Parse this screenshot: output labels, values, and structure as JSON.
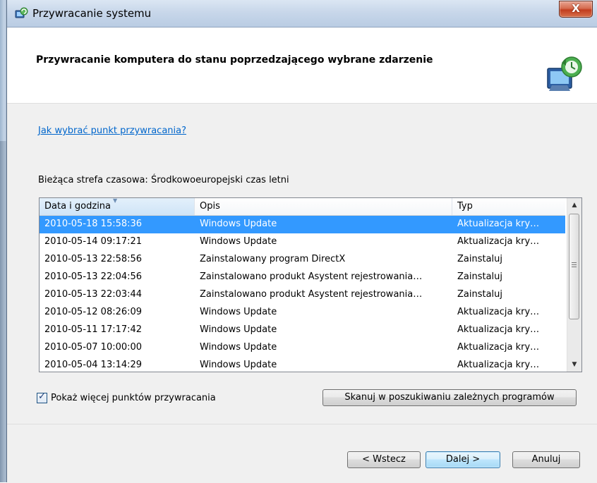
{
  "window": {
    "title": "Przywracanie systemu",
    "close_label": "X"
  },
  "header": {
    "heading": "Przywracanie komputera do stanu poprzedzającego wybrane zdarzenie"
  },
  "content": {
    "help_link": "Jak wybrać punkt przywracania?",
    "timezone_label": "Bieżąca strefa czasowa: Środkowoeuropejski czas letni",
    "columns": [
      "Data i godzina",
      "Opis",
      "Typ"
    ],
    "rows": [
      {
        "date": "2010-05-18 15:58:36",
        "desc": "Windows Update",
        "type": "Aktualizacja kry…",
        "selected": true
      },
      {
        "date": "2010-05-14 09:17:21",
        "desc": "Windows Update",
        "type": "Aktualizacja kry…"
      },
      {
        "date": "2010-05-13 22:58:56",
        "desc": "Zainstalowany program DirectX",
        "type": "Zainstaluj"
      },
      {
        "date": "2010-05-13 22:04:56",
        "desc": "Zainstalowano produkt Asystent rejestrowania…",
        "type": "Zainstaluj"
      },
      {
        "date": "2010-05-13 22:03:44",
        "desc": "Zainstalowano produkt Asystent rejestrowania…",
        "type": "Zainstaluj"
      },
      {
        "date": "2010-05-12 08:26:09",
        "desc": "Windows Update",
        "type": "Aktualizacja kry…"
      },
      {
        "date": "2010-05-11 17:17:42",
        "desc": "Windows Update",
        "type": "Aktualizacja kry…"
      },
      {
        "date": "2010-05-07 10:00:00",
        "desc": "Windows Update",
        "type": "Aktualizacja kry…"
      },
      {
        "date": "2010-05-04 13:14:29",
        "desc": "Windows Update",
        "type": "Aktualizacja kry…"
      }
    ],
    "show_more_label": "Pokaż więcej punktów przywracania",
    "show_more_checked": true,
    "scan_button": "Skanuj w poszukiwaniu zależnych programów"
  },
  "footer": {
    "back": "< Wstecz",
    "next": "Dalej >",
    "cancel": "Anuluj"
  },
  "colors": {
    "selection": "#3399ff",
    "link": "#0066cc",
    "close": "#c23e1e"
  }
}
